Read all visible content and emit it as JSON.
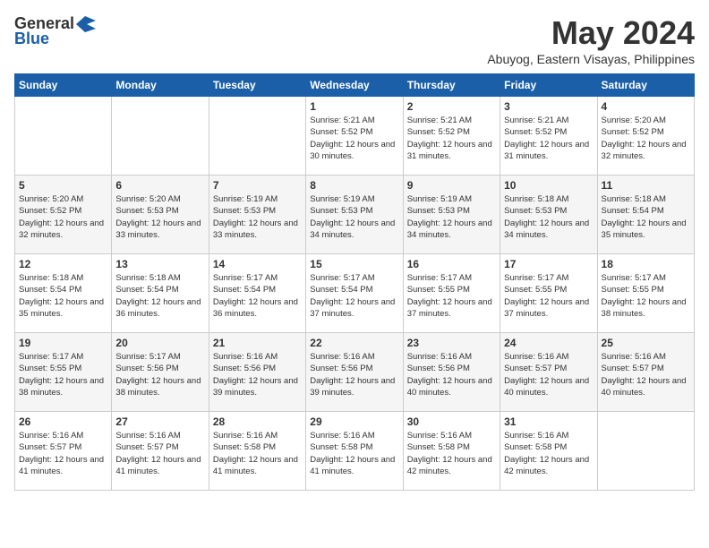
{
  "header": {
    "logo_general": "General",
    "logo_blue": "Blue",
    "month_title": "May 2024",
    "location": "Abuyog, Eastern Visayas, Philippines"
  },
  "weekdays": [
    "Sunday",
    "Monday",
    "Tuesday",
    "Wednesday",
    "Thursday",
    "Friday",
    "Saturday"
  ],
  "weeks": [
    [
      {
        "day": "",
        "text": ""
      },
      {
        "day": "",
        "text": ""
      },
      {
        "day": "",
        "text": ""
      },
      {
        "day": "1",
        "text": "Sunrise: 5:21 AM\nSunset: 5:52 PM\nDaylight: 12 hours and 30 minutes."
      },
      {
        "day": "2",
        "text": "Sunrise: 5:21 AM\nSunset: 5:52 PM\nDaylight: 12 hours and 31 minutes."
      },
      {
        "day": "3",
        "text": "Sunrise: 5:21 AM\nSunset: 5:52 PM\nDaylight: 12 hours and 31 minutes."
      },
      {
        "day": "4",
        "text": "Sunrise: 5:20 AM\nSunset: 5:52 PM\nDaylight: 12 hours and 32 minutes."
      }
    ],
    [
      {
        "day": "5",
        "text": "Sunrise: 5:20 AM\nSunset: 5:52 PM\nDaylight: 12 hours and 32 minutes."
      },
      {
        "day": "6",
        "text": "Sunrise: 5:20 AM\nSunset: 5:53 PM\nDaylight: 12 hours and 33 minutes."
      },
      {
        "day": "7",
        "text": "Sunrise: 5:19 AM\nSunset: 5:53 PM\nDaylight: 12 hours and 33 minutes."
      },
      {
        "day": "8",
        "text": "Sunrise: 5:19 AM\nSunset: 5:53 PM\nDaylight: 12 hours and 34 minutes."
      },
      {
        "day": "9",
        "text": "Sunrise: 5:19 AM\nSunset: 5:53 PM\nDaylight: 12 hours and 34 minutes."
      },
      {
        "day": "10",
        "text": "Sunrise: 5:18 AM\nSunset: 5:53 PM\nDaylight: 12 hours and 34 minutes."
      },
      {
        "day": "11",
        "text": "Sunrise: 5:18 AM\nSunset: 5:54 PM\nDaylight: 12 hours and 35 minutes."
      }
    ],
    [
      {
        "day": "12",
        "text": "Sunrise: 5:18 AM\nSunset: 5:54 PM\nDaylight: 12 hours and 35 minutes."
      },
      {
        "day": "13",
        "text": "Sunrise: 5:18 AM\nSunset: 5:54 PM\nDaylight: 12 hours and 36 minutes."
      },
      {
        "day": "14",
        "text": "Sunrise: 5:17 AM\nSunset: 5:54 PM\nDaylight: 12 hours and 36 minutes."
      },
      {
        "day": "15",
        "text": "Sunrise: 5:17 AM\nSunset: 5:54 PM\nDaylight: 12 hours and 37 minutes."
      },
      {
        "day": "16",
        "text": "Sunrise: 5:17 AM\nSunset: 5:55 PM\nDaylight: 12 hours and 37 minutes."
      },
      {
        "day": "17",
        "text": "Sunrise: 5:17 AM\nSunset: 5:55 PM\nDaylight: 12 hours and 37 minutes."
      },
      {
        "day": "18",
        "text": "Sunrise: 5:17 AM\nSunset: 5:55 PM\nDaylight: 12 hours and 38 minutes."
      }
    ],
    [
      {
        "day": "19",
        "text": "Sunrise: 5:17 AM\nSunset: 5:55 PM\nDaylight: 12 hours and 38 minutes."
      },
      {
        "day": "20",
        "text": "Sunrise: 5:17 AM\nSunset: 5:56 PM\nDaylight: 12 hours and 38 minutes."
      },
      {
        "day": "21",
        "text": "Sunrise: 5:16 AM\nSunset: 5:56 PM\nDaylight: 12 hours and 39 minutes."
      },
      {
        "day": "22",
        "text": "Sunrise: 5:16 AM\nSunset: 5:56 PM\nDaylight: 12 hours and 39 minutes."
      },
      {
        "day": "23",
        "text": "Sunrise: 5:16 AM\nSunset: 5:56 PM\nDaylight: 12 hours and 40 minutes."
      },
      {
        "day": "24",
        "text": "Sunrise: 5:16 AM\nSunset: 5:57 PM\nDaylight: 12 hours and 40 minutes."
      },
      {
        "day": "25",
        "text": "Sunrise: 5:16 AM\nSunset: 5:57 PM\nDaylight: 12 hours and 40 minutes."
      }
    ],
    [
      {
        "day": "26",
        "text": "Sunrise: 5:16 AM\nSunset: 5:57 PM\nDaylight: 12 hours and 41 minutes."
      },
      {
        "day": "27",
        "text": "Sunrise: 5:16 AM\nSunset: 5:57 PM\nDaylight: 12 hours and 41 minutes."
      },
      {
        "day": "28",
        "text": "Sunrise: 5:16 AM\nSunset: 5:58 PM\nDaylight: 12 hours and 41 minutes."
      },
      {
        "day": "29",
        "text": "Sunrise: 5:16 AM\nSunset: 5:58 PM\nDaylight: 12 hours and 41 minutes."
      },
      {
        "day": "30",
        "text": "Sunrise: 5:16 AM\nSunset: 5:58 PM\nDaylight: 12 hours and 42 minutes."
      },
      {
        "day": "31",
        "text": "Sunrise: 5:16 AM\nSunset: 5:58 PM\nDaylight: 12 hours and 42 minutes."
      },
      {
        "day": "",
        "text": ""
      }
    ]
  ]
}
